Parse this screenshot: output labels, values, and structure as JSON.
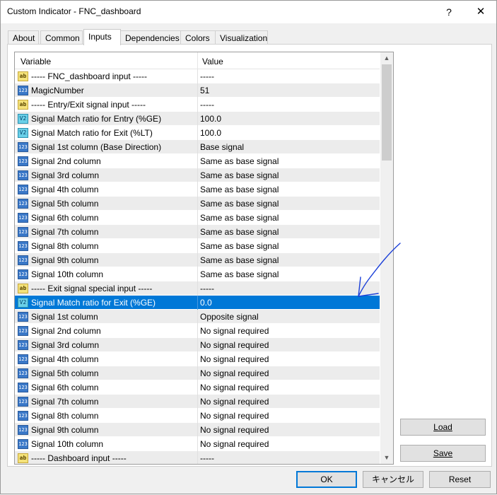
{
  "window": {
    "title": "Custom Indicator - FNC_dashboard",
    "help_glyph": "?",
    "close_glyph": "✕"
  },
  "tabs": [
    {
      "label": "About"
    },
    {
      "label": "Common"
    },
    {
      "label": "Inputs",
      "active": true
    },
    {
      "label": "Dependencies"
    },
    {
      "label": "Colors"
    },
    {
      "label": "Visualization"
    }
  ],
  "grid": {
    "columns": {
      "variable": "Variable",
      "value": "Value"
    },
    "rows": [
      {
        "icon": "ab",
        "variable": "----- FNC_dashboard input -----",
        "value": "-----"
      },
      {
        "icon": "123",
        "variable": "MagicNumber",
        "value": "51"
      },
      {
        "icon": "ab",
        "variable": "----- Entry/Exit signal input -----",
        "value": "-----"
      },
      {
        "icon": "v2",
        "variable": "Signal Match ratio for Entry (%GE)",
        "value": "100.0"
      },
      {
        "icon": "v2",
        "variable": "Signal Match ratio for Exit (%LT)",
        "value": "100.0"
      },
      {
        "icon": "123",
        "variable": "Signal 1st column (Base Direction)",
        "value": "Base signal"
      },
      {
        "icon": "123",
        "variable": "Signal 2nd column",
        "value": "Same as base signal"
      },
      {
        "icon": "123",
        "variable": "Signal 3rd column",
        "value": "Same as base signal"
      },
      {
        "icon": "123",
        "variable": "Signal 4th column",
        "value": "Same as base signal"
      },
      {
        "icon": "123",
        "variable": "Signal 5th column",
        "value": "Same as base signal"
      },
      {
        "icon": "123",
        "variable": "Signal 6th column",
        "value": "Same as base signal"
      },
      {
        "icon": "123",
        "variable": "Signal 7th column",
        "value": "Same as base signal"
      },
      {
        "icon": "123",
        "variable": "Signal 8th column",
        "value": "Same as base signal"
      },
      {
        "icon": "123",
        "variable": "Signal 9th column",
        "value": "Same as base signal"
      },
      {
        "icon": "123",
        "variable": "Signal 10th column",
        "value": "Same as base signal"
      },
      {
        "icon": "ab",
        "variable": "----- Exit signal special input -----",
        "value": "-----"
      },
      {
        "icon": "v2",
        "variable": "Signal Match ratio for Exit (%GE)",
        "value": "0.0",
        "selected": true
      },
      {
        "icon": "123",
        "variable": "Signal 1st column",
        "value": "Opposite signal"
      },
      {
        "icon": "123",
        "variable": "Signal 2nd column",
        "value": "No signal required"
      },
      {
        "icon": "123",
        "variable": "Signal 3rd column",
        "value": "No signal required"
      },
      {
        "icon": "123",
        "variable": "Signal 4th column",
        "value": "No signal required"
      },
      {
        "icon": "123",
        "variable": "Signal 5th column",
        "value": "No signal required"
      },
      {
        "icon": "123",
        "variable": "Signal 6th column",
        "value": "No signal required"
      },
      {
        "icon": "123",
        "variable": "Signal 7th column",
        "value": "No signal required"
      },
      {
        "icon": "123",
        "variable": "Signal 8th column",
        "value": "No signal required"
      },
      {
        "icon": "123",
        "variable": "Signal 9th column",
        "value": "No signal required"
      },
      {
        "icon": "123",
        "variable": "Signal 10th column",
        "value": "No signal required"
      },
      {
        "icon": "ab",
        "variable": "----- Dashboard input -----",
        "value": "-----"
      }
    ],
    "icon_labels": {
      "ab": "ab",
      "123": "123",
      "v2": "V2"
    }
  },
  "side_buttons": {
    "load_label": "Load",
    "save_label": "Save"
  },
  "footer": {
    "ok_label": "OK",
    "cancel_label": "キャンセル",
    "reset_label": "Reset"
  },
  "colors": {
    "selection": "#0078d7",
    "annotation_arrow": "#1a3fd8"
  }
}
